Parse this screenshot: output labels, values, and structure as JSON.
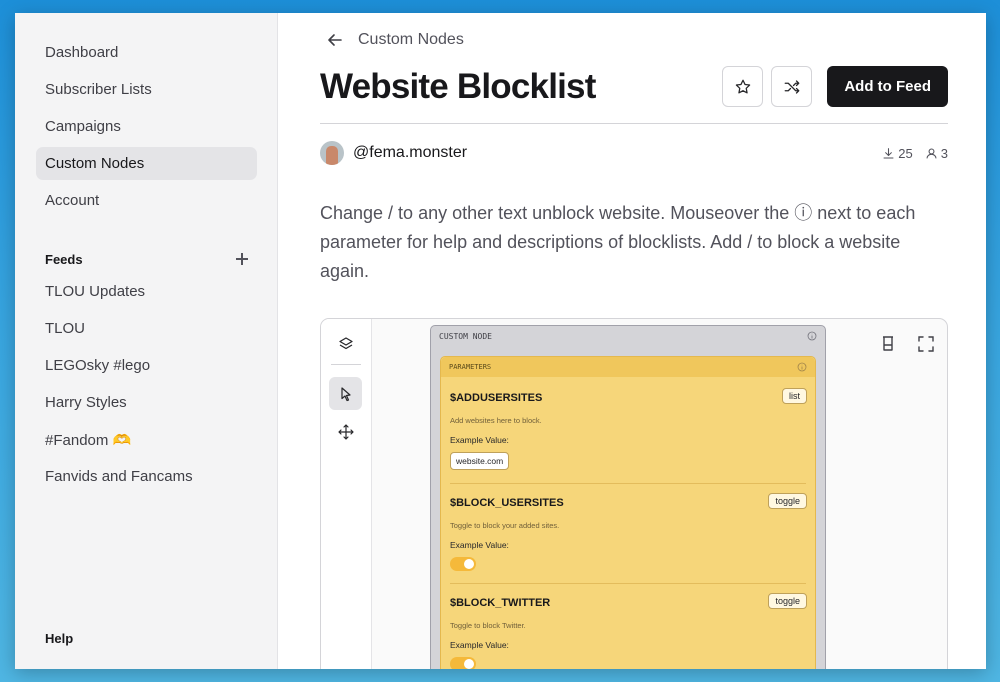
{
  "sidebar": {
    "nav": [
      {
        "label": "Dashboard"
      },
      {
        "label": "Subscriber Lists"
      },
      {
        "label": "Campaigns"
      },
      {
        "label": "Custom Nodes",
        "active": true
      },
      {
        "label": "Account"
      }
    ],
    "feeds_title": "Feeds",
    "feeds": [
      {
        "label": "TLOU Updates"
      },
      {
        "label": "TLOU"
      },
      {
        "label": "LEGOsky #lego"
      },
      {
        "label": "Harry Styles"
      },
      {
        "label": "#Fandom 🫶"
      },
      {
        "label": "Fanvids and Fancams"
      }
    ],
    "help": "Help"
  },
  "header": {
    "breadcrumb": "Custom Nodes",
    "title": "Website Blocklist",
    "add_button": "Add to Feed",
    "star_icon": "star-icon",
    "shuffle_icon": "shuffle-icon"
  },
  "author": {
    "handle": "@fema.monster",
    "downloads": "25",
    "users": "3"
  },
  "description": "Change / to any other text unblock website. Mouseover the ⓘ next to each parameter for help and descriptions of blocklists. Add / to block a website again.",
  "node": {
    "header": "CUSTOM NODE",
    "params_header": "PARAMETERS",
    "params": [
      {
        "name": "$ADDUSERSITES",
        "type": "list",
        "desc": "Add websites here to block.",
        "example_label": "Example Value:",
        "example": "website.com"
      },
      {
        "name": "$BLOCK_USERSITES",
        "type": "toggle",
        "desc": "Toggle to block your added sites.",
        "example_label": "Example Value:",
        "toggle_on": true
      },
      {
        "name": "$BLOCK_TWITTER",
        "type": "toggle",
        "desc": "Toggle to block Twitter.",
        "example_label": "Example Value:",
        "toggle_on": true
      }
    ]
  },
  "colors": {
    "accent": "#18181b",
    "param_bg": "#f6d67a",
    "toggle_on": "#f5b93a"
  }
}
